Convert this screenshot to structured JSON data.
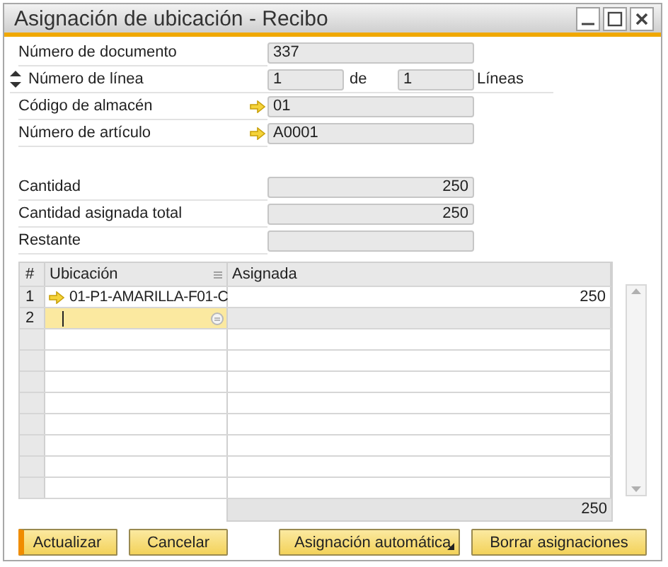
{
  "window": {
    "title": "Asignación de ubicación - Recibo"
  },
  "header_fields": [
    {
      "kind": "plain",
      "label": "Número de documento",
      "value": "337"
    },
    {
      "kind": "line",
      "label": "Número de línea",
      "value": "1",
      "of_label": "de",
      "total": "1",
      "unit": "Líneas"
    },
    {
      "kind": "link",
      "label": "Código de almacén",
      "value": "01"
    },
    {
      "kind": "link",
      "label": "Número de artículo",
      "value": "A0001"
    }
  ],
  "quantities": [
    {
      "label": "Cantidad",
      "value": "250"
    },
    {
      "label": "Cantidad asignada total",
      "value": "250"
    },
    {
      "label": "Restante"
    }
  ],
  "grid": {
    "columns": [
      "#",
      "Ubicación",
      "Asignada"
    ],
    "rows": [
      {
        "number": "1",
        "location": "01-P1-AMARILLA-F01-C",
        "link": true,
        "assigned": "250",
        "selected": false
      },
      {
        "number": "2",
        "location": "",
        "link": false,
        "assigned": "",
        "selected": true
      }
    ],
    "total": "250"
  },
  "buttons": [
    {
      "label": "Actualizar",
      "kind": "default"
    },
    {
      "label": "Cancelar",
      "kind": "plain"
    },
    {
      "label": "Asignación automática",
      "kind": "menu"
    },
    {
      "label": "Borrar asignaciones",
      "kind": "plain"
    }
  ]
}
